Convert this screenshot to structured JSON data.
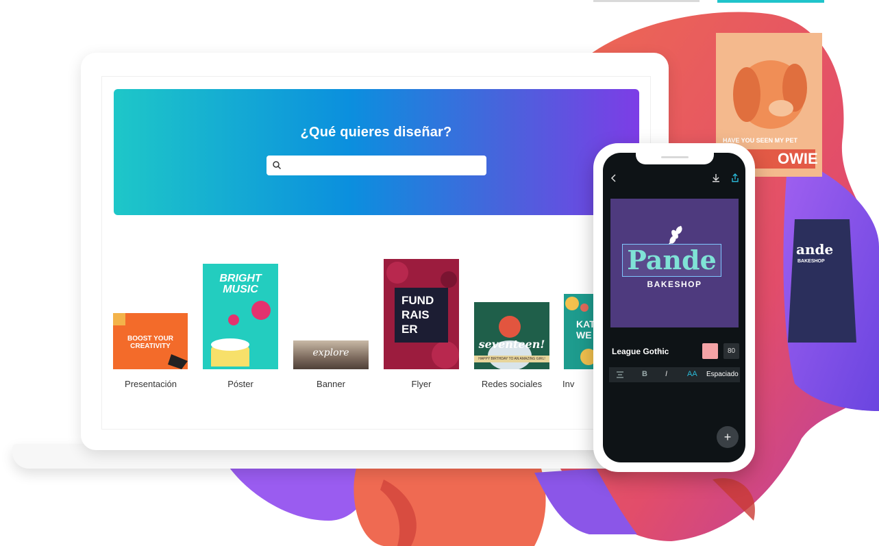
{
  "hero": {
    "title": "¿Qué quieres diseñar?",
    "search_placeholder": ""
  },
  "categories": [
    {
      "label": "Presentación",
      "card_text": [
        "BOOST YOUR",
        "CREATIVITY"
      ]
    },
    {
      "label": "Póster",
      "card_text": [
        "BRIGHT",
        "MUSIC"
      ]
    },
    {
      "label": "Banner",
      "card_text": [
        "explore"
      ]
    },
    {
      "label": "Flyer",
      "card_text": [
        "FUND",
        "RAIS",
        "ER"
      ]
    },
    {
      "label": "Redes sociales",
      "card_text": [
        "seventeen!",
        "HAPPY BIRTHDAY TO AN AMAZING GIRL!"
      ]
    },
    {
      "label": "Inv",
      "card_text": [
        "KAT",
        "WE"
      ]
    }
  ],
  "phone": {
    "design_title": "Pande",
    "design_subtitle": "BAKESHOP",
    "font_name": "League Gothic",
    "font_size": "80",
    "text_color": "#f4a3a6",
    "format_items": [
      "B",
      "I",
      "AA",
      "Espaciado"
    ]
  },
  "background": {
    "pet_poster_text": "HAVE YOU SEEN MY PET",
    "pet_name_partial": "OWIE",
    "apron_text": "ande",
    "apron_sub": "BAKESHOP"
  },
  "colors": {
    "hero_start": "#1ec7c8",
    "hero_end": "#7d3de6",
    "blob_red": "#e8545e",
    "blob_purple": "#8b56e8",
    "blob_coral": "#ef6a52"
  }
}
